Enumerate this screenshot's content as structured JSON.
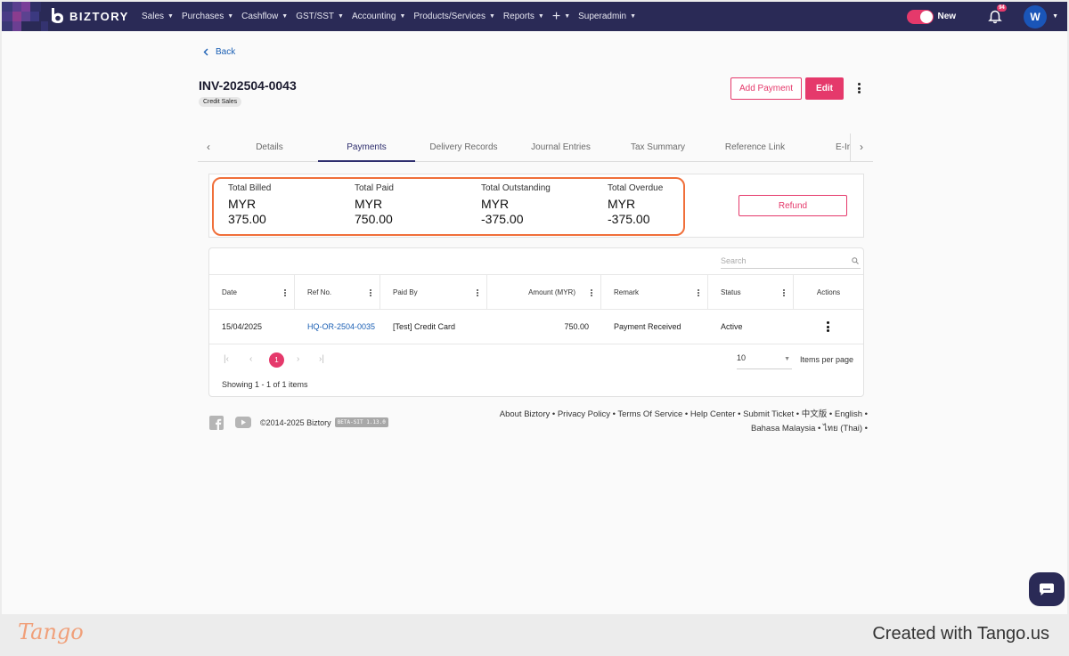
{
  "colors": {
    "nav_bg": "#2a2a56",
    "accent": "#e5396b",
    "highlight_outline": "#f06f3a",
    "link": "#1a5fb4"
  },
  "nav": {
    "brand": "BIZTORY",
    "menu": [
      {
        "label": "Sales",
        "icon": "chevron-down-icon"
      },
      {
        "label": "Purchases",
        "icon": "chevron-down-icon"
      },
      {
        "label": "Cashflow",
        "icon": "chevron-down-icon"
      },
      {
        "label": "GST/SST",
        "icon": "chevron-down-icon"
      },
      {
        "label": "Accounting",
        "icon": "chevron-down-icon"
      },
      {
        "label": "Products/Services",
        "icon": "chevron-down-icon"
      },
      {
        "label": "Reports",
        "icon": "chevron-down-icon"
      },
      {
        "label": "+",
        "icon": "plus-icon"
      },
      {
        "label": "Superadmin",
        "icon": "chevron-down-icon"
      }
    ],
    "toggle_label": "New",
    "notification_count": "94",
    "avatar_initial": "W"
  },
  "page": {
    "back_label": "Back",
    "invoice_number": "INV-202504-0043",
    "type_badge": "Credit Sales",
    "add_payment_label": "Add Payment",
    "edit_label": "Edit"
  },
  "tabs": [
    {
      "label": "Details",
      "active": false
    },
    {
      "label": "Payments",
      "active": true
    },
    {
      "label": "Delivery Records",
      "active": false
    },
    {
      "label": "Journal Entries",
      "active": false
    },
    {
      "label": "Tax Summary",
      "active": false
    },
    {
      "label": "Reference Link",
      "active": false
    },
    {
      "label": "E-Inv",
      "active": false
    }
  ],
  "summary": {
    "stats": [
      {
        "label": "Total Billed",
        "currency": "MYR",
        "value": "375.00"
      },
      {
        "label": "Total Paid",
        "currency": "MYR",
        "value": "750.00"
      },
      {
        "label": "Total Outstanding",
        "currency": "MYR",
        "value": "-375.00"
      },
      {
        "label": "Total Overdue",
        "currency": "MYR",
        "value": "-375.00"
      }
    ],
    "refund_label": "Refund"
  },
  "table": {
    "search_placeholder": "Search",
    "columns": [
      "Date",
      "Ref No.",
      "Paid By",
      "Amount (MYR)",
      "Remark",
      "Status",
      "Actions"
    ],
    "rows": [
      {
        "date": "15/04/2025",
        "ref_no": "HQ-OR-2504-0035",
        "paid_by": "[Test] Credit Card",
        "amount": "750.00",
        "remark": "Payment Received",
        "status": "Active"
      }
    ],
    "current_page": "1",
    "items_per_page_value": "10",
    "items_per_page_label": "Items per page",
    "showing": "Showing 1 - 1 of 1 items"
  },
  "footer": {
    "copyright": "©2014-2025 Biztory",
    "version": "BETA-SIT 1.13.0",
    "links_line1": "About Biztory • Privacy Policy • Terms Of Service • Help Center • Submit Ticket • 中文版 • English •",
    "links_line2": "Bahasa Malaysia • ไทย (Thai) •"
  },
  "tango": {
    "logo": "Tango",
    "credit": "Created with Tango.us"
  }
}
